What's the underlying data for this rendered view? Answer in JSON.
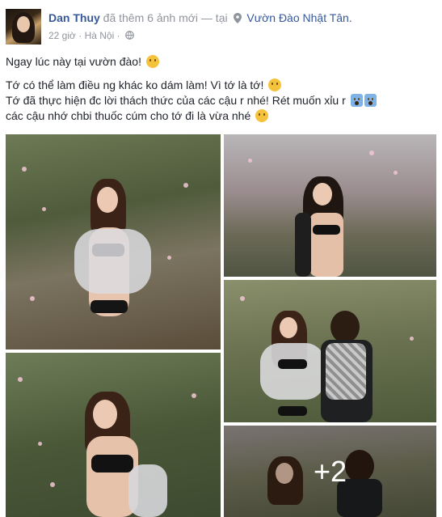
{
  "post": {
    "author": "Dan Thuy",
    "action": "đã thêm 6 ảnh mới — tại",
    "place": "Vườn Đào Nhật Tân.",
    "time": "22 giờ",
    "location": "Hà Nội",
    "separator": "·",
    "lines": [
      "Ngay lúc này tại vườn đào!",
      "Tớ có thể làm điều ng khác ko dám làm! Vì tớ là tớ!",
      "Tớ đã thực hiện đc lời thách thức của các cậu r nhé! Rét muốn xỉu r",
      "các cậu nhớ chbi thuốc cúm cho tớ đi là vừa nhé"
    ],
    "more_photos": "+2"
  },
  "icons": {
    "location": "location-pin-icon",
    "audience": "globe-icon"
  },
  "colors": {
    "link": "#365899",
    "meta": "#90949c",
    "text": "#1d2129"
  }
}
